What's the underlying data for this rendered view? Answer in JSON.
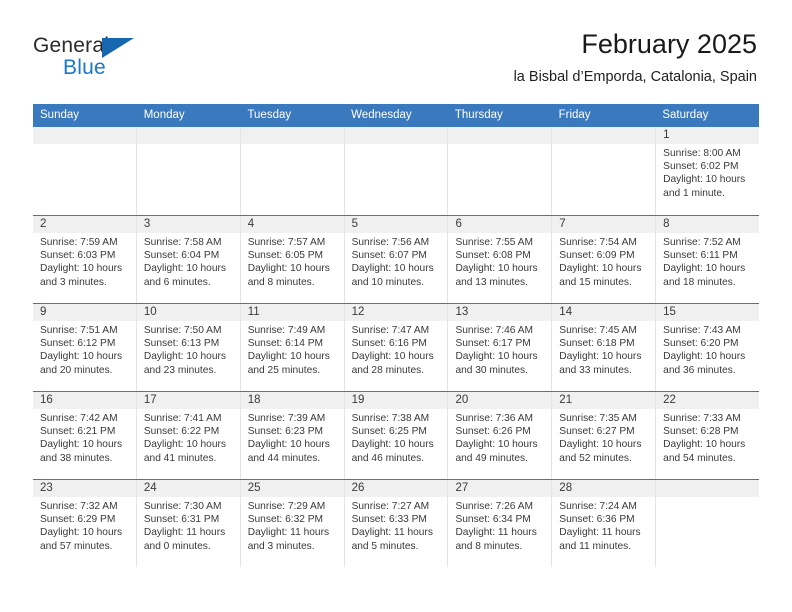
{
  "logo": {
    "word_one": "General",
    "word_two": "Blue",
    "triangle_color": "#1767b0",
    "blue_color": "#1b77c8"
  },
  "header": {
    "title": "February 2025",
    "subtitle": "la Bisbal d’Emporda, Catalonia, Spain"
  },
  "theme": {
    "header_blue": "#3a79bd",
    "day_band": "#f0f0f0",
    "cell_border": "#e3e3e3"
  },
  "weekdays": [
    "Sunday",
    "Monday",
    "Tuesday",
    "Wednesday",
    "Thursday",
    "Friday",
    "Saturday"
  ],
  "weeks": [
    [
      {
        "day": "",
        "sunrise": "",
        "sunset": "",
        "daylight_line1": "",
        "daylight_line2": ""
      },
      {
        "day": "",
        "sunrise": "",
        "sunset": "",
        "daylight_line1": "",
        "daylight_line2": ""
      },
      {
        "day": "",
        "sunrise": "",
        "sunset": "",
        "daylight_line1": "",
        "daylight_line2": ""
      },
      {
        "day": "",
        "sunrise": "",
        "sunset": "",
        "daylight_line1": "",
        "daylight_line2": ""
      },
      {
        "day": "",
        "sunrise": "",
        "sunset": "",
        "daylight_line1": "",
        "daylight_line2": ""
      },
      {
        "day": "",
        "sunrise": "",
        "sunset": "",
        "daylight_line1": "",
        "daylight_line2": ""
      },
      {
        "day": "1",
        "sunrise": "Sunrise: 8:00 AM",
        "sunset": "Sunset: 6:02 PM",
        "daylight_line1": "Daylight: 10 hours",
        "daylight_line2": "and 1 minute."
      }
    ],
    [
      {
        "day": "2",
        "sunrise": "Sunrise: 7:59 AM",
        "sunset": "Sunset: 6:03 PM",
        "daylight_line1": "Daylight: 10 hours",
        "daylight_line2": "and 3 minutes."
      },
      {
        "day": "3",
        "sunrise": "Sunrise: 7:58 AM",
        "sunset": "Sunset: 6:04 PM",
        "daylight_line1": "Daylight: 10 hours",
        "daylight_line2": "and 6 minutes."
      },
      {
        "day": "4",
        "sunrise": "Sunrise: 7:57 AM",
        "sunset": "Sunset: 6:05 PM",
        "daylight_line1": "Daylight: 10 hours",
        "daylight_line2": "and 8 minutes."
      },
      {
        "day": "5",
        "sunrise": "Sunrise: 7:56 AM",
        "sunset": "Sunset: 6:07 PM",
        "daylight_line1": "Daylight: 10 hours",
        "daylight_line2": "and 10 minutes."
      },
      {
        "day": "6",
        "sunrise": "Sunrise: 7:55 AM",
        "sunset": "Sunset: 6:08 PM",
        "daylight_line1": "Daylight: 10 hours",
        "daylight_line2": "and 13 minutes."
      },
      {
        "day": "7",
        "sunrise": "Sunrise: 7:54 AM",
        "sunset": "Sunset: 6:09 PM",
        "daylight_line1": "Daylight: 10 hours",
        "daylight_line2": "and 15 minutes."
      },
      {
        "day": "8",
        "sunrise": "Sunrise: 7:52 AM",
        "sunset": "Sunset: 6:11 PM",
        "daylight_line1": "Daylight: 10 hours",
        "daylight_line2": "and 18 minutes."
      }
    ],
    [
      {
        "day": "9",
        "sunrise": "Sunrise: 7:51 AM",
        "sunset": "Sunset: 6:12 PM",
        "daylight_line1": "Daylight: 10 hours",
        "daylight_line2": "and 20 minutes."
      },
      {
        "day": "10",
        "sunrise": "Sunrise: 7:50 AM",
        "sunset": "Sunset: 6:13 PM",
        "daylight_line1": "Daylight: 10 hours",
        "daylight_line2": "and 23 minutes."
      },
      {
        "day": "11",
        "sunrise": "Sunrise: 7:49 AM",
        "sunset": "Sunset: 6:14 PM",
        "daylight_line1": "Daylight: 10 hours",
        "daylight_line2": "and 25 minutes."
      },
      {
        "day": "12",
        "sunrise": "Sunrise: 7:47 AM",
        "sunset": "Sunset: 6:16 PM",
        "daylight_line1": "Daylight: 10 hours",
        "daylight_line2": "and 28 minutes."
      },
      {
        "day": "13",
        "sunrise": "Sunrise: 7:46 AM",
        "sunset": "Sunset: 6:17 PM",
        "daylight_line1": "Daylight: 10 hours",
        "daylight_line2": "and 30 minutes."
      },
      {
        "day": "14",
        "sunrise": "Sunrise: 7:45 AM",
        "sunset": "Sunset: 6:18 PM",
        "daylight_line1": "Daylight: 10 hours",
        "daylight_line2": "and 33 minutes."
      },
      {
        "day": "15",
        "sunrise": "Sunrise: 7:43 AM",
        "sunset": "Sunset: 6:20 PM",
        "daylight_line1": "Daylight: 10 hours",
        "daylight_line2": "and 36 minutes."
      }
    ],
    [
      {
        "day": "16",
        "sunrise": "Sunrise: 7:42 AM",
        "sunset": "Sunset: 6:21 PM",
        "daylight_line1": "Daylight: 10 hours",
        "daylight_line2": "and 38 minutes."
      },
      {
        "day": "17",
        "sunrise": "Sunrise: 7:41 AM",
        "sunset": "Sunset: 6:22 PM",
        "daylight_line1": "Daylight: 10 hours",
        "daylight_line2": "and 41 minutes."
      },
      {
        "day": "18",
        "sunrise": "Sunrise: 7:39 AM",
        "sunset": "Sunset: 6:23 PM",
        "daylight_line1": "Daylight: 10 hours",
        "daylight_line2": "and 44 minutes."
      },
      {
        "day": "19",
        "sunrise": "Sunrise: 7:38 AM",
        "sunset": "Sunset: 6:25 PM",
        "daylight_line1": "Daylight: 10 hours",
        "daylight_line2": "and 46 minutes."
      },
      {
        "day": "20",
        "sunrise": "Sunrise: 7:36 AM",
        "sunset": "Sunset: 6:26 PM",
        "daylight_line1": "Daylight: 10 hours",
        "daylight_line2": "and 49 minutes."
      },
      {
        "day": "21",
        "sunrise": "Sunrise: 7:35 AM",
        "sunset": "Sunset: 6:27 PM",
        "daylight_line1": "Daylight: 10 hours",
        "daylight_line2": "and 52 minutes."
      },
      {
        "day": "22",
        "sunrise": "Sunrise: 7:33 AM",
        "sunset": "Sunset: 6:28 PM",
        "daylight_line1": "Daylight: 10 hours",
        "daylight_line2": "and 54 minutes."
      }
    ],
    [
      {
        "day": "23",
        "sunrise": "Sunrise: 7:32 AM",
        "sunset": "Sunset: 6:29 PM",
        "daylight_line1": "Daylight: 10 hours",
        "daylight_line2": "and 57 minutes."
      },
      {
        "day": "24",
        "sunrise": "Sunrise: 7:30 AM",
        "sunset": "Sunset: 6:31 PM",
        "daylight_line1": "Daylight: 11 hours",
        "daylight_line2": "and 0 minutes."
      },
      {
        "day": "25",
        "sunrise": "Sunrise: 7:29 AM",
        "sunset": "Sunset: 6:32 PM",
        "daylight_line1": "Daylight: 11 hours",
        "daylight_line2": "and 3 minutes."
      },
      {
        "day": "26",
        "sunrise": "Sunrise: 7:27 AM",
        "sunset": "Sunset: 6:33 PM",
        "daylight_line1": "Daylight: 11 hours",
        "daylight_line2": "and 5 minutes."
      },
      {
        "day": "27",
        "sunrise": "Sunrise: 7:26 AM",
        "sunset": "Sunset: 6:34 PM",
        "daylight_line1": "Daylight: 11 hours",
        "daylight_line2": "and 8 minutes."
      },
      {
        "day": "28",
        "sunrise": "Sunrise: 7:24 AM",
        "sunset": "Sunset: 6:36 PM",
        "daylight_line1": "Daylight: 11 hours",
        "daylight_line2": "and 11 minutes."
      },
      {
        "day": "",
        "sunrise": "",
        "sunset": "",
        "daylight_line1": "",
        "daylight_line2": ""
      }
    ]
  ]
}
